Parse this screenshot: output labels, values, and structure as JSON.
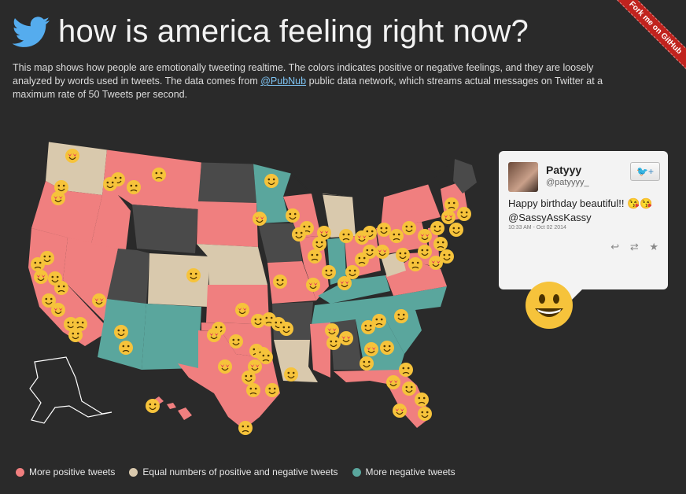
{
  "header": {
    "title": "how is america feeling right now?"
  },
  "description": {
    "part1": "This map shows how people are emotionally tweeting realtime. The colors indicates positive or negative feelings, and they are loosely analyzed by words used in tweets. The data comes from ",
    "link": "@PubNub",
    "part2": " public data network, which streams actual messages on Twitter at a maximum rate of 50 Tweets per second."
  },
  "ribbon": {
    "label": "Fork me on GitHub"
  },
  "tweet": {
    "name": "Patyyy",
    "handle": "@patyyyy_",
    "text_line1": "Happy birthday beautiful!! 😘😘",
    "text_line2": "@SassyAssKassy",
    "time": "10:33 AM - Oct 02 2014",
    "follow_label": "+",
    "actions": {
      "reply": "↩",
      "retweet": "⇄",
      "favorite": "★"
    }
  },
  "legend": [
    {
      "label": "More positive tweets",
      "color": "#f07f7f"
    },
    {
      "label": "Equal numbers of positive and negative tweets",
      "color": "#d9c9ad"
    },
    {
      "label": "More negative tweets",
      "color": "#5aa69d"
    }
  ],
  "colors": {
    "background": "#2a2a2a",
    "positive": "#f07f7f",
    "neutral": "#d9c9ad",
    "negative": "#5aa69d",
    "nodata": "#4a4a4a",
    "emoji": "#f6c33b",
    "link": "#7ec3f2"
  }
}
